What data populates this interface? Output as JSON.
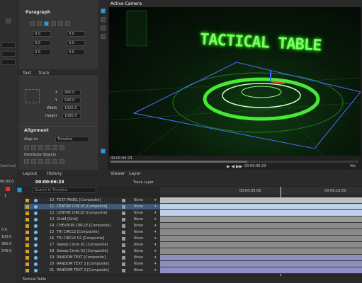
{
  "left_strip": {
    "label": "(Vertical)"
  },
  "paragraph": {
    "title": "Paragraph",
    "tabs": [
      "Text",
      "Track"
    ],
    "fields": [
      "0.0",
      "0.0",
      "0.0",
      "0.0",
      "0.0",
      "0.0"
    ],
    "x_label": "X",
    "x_val": "960.0",
    "y_label": "Y",
    "y_val": "540.0",
    "width_label": "Width",
    "width_val": "1920.0",
    "height_label": "Height",
    "height_val": "1080.0"
  },
  "alignment": {
    "title": "Alignment",
    "align_to_label": "Align to",
    "align_to_value": "Timeline",
    "distribute_label": "Distribute Objects"
  },
  "bottom_tabs_left": [
    "Layout",
    "History"
  ],
  "viewer": {
    "tab": "Active Camera",
    "title_text": "TACTICAL TABLE",
    "timecode": "00:00:06:23",
    "tabs": [
      "Viewer",
      "Layer"
    ],
    "playback": "▶ ◀ ▶▶",
    "right_label": "Vie"
  },
  "timeline": {
    "timecode": "00:00:06:23",
    "trace_label": "Trace Layer",
    "search_placeholder": "Search in Timeline",
    "ruler": [
      "00:00:05:00",
      "00:00:10:00"
    ],
    "tab": "Tactical Table",
    "layers": [
      {
        "num": "10",
        "name": "TEXT PANEL [Composite]",
        "blend": "None"
      },
      {
        "num": "11",
        "name": "CENTRE CIRCLE [Composite]",
        "blend": "None"
      },
      {
        "num": "12",
        "name": "CENTRE CIRCLE [Composite]",
        "blend": "None"
      },
      {
        "num": "13",
        "name": "Grid4 [Grid]",
        "blend": "None"
      },
      {
        "num": "14",
        "name": "CHEVRON CIRCLE [Composite]",
        "blend": "None"
      },
      {
        "num": "15",
        "name": "TRI CIRCLE [Composite]",
        "blend": "None"
      },
      {
        "num": "16",
        "name": "TRI CIRCLE 02 [Composite]",
        "blend": "None"
      },
      {
        "num": "17",
        "name": "Sweep Circle 01 [Composite]",
        "blend": "None"
      },
      {
        "num": "18",
        "name": "Sweep Circle 02 [Composite]",
        "blend": "None"
      },
      {
        "num": "19",
        "name": "RANDOM TEXT [Composite]",
        "blend": "None"
      },
      {
        "num": "20",
        "name": "RANDOM TEXT 2 [Composite]",
        "blend": "None"
      },
      {
        "num": "21",
        "name": "RANDOM TEXT 3 [Composite]",
        "blend": "None"
      }
    ]
  },
  "far_left": {
    "time": "00:00:0",
    "values": [
      "1",
      "0.0",
      "100.0",
      "960.0",
      "540.0"
    ]
  }
}
